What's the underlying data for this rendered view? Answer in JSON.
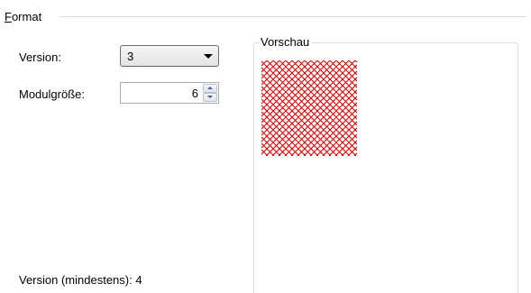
{
  "format": {
    "title_underlined": "F",
    "title_rest": "ormat"
  },
  "version": {
    "label": "Version:",
    "selected": "3"
  },
  "module_size": {
    "label": "Modulgröße:",
    "value": "6"
  },
  "preview": {
    "title": "Vorschau",
    "pattern_color": "#ff0000"
  },
  "min_version": {
    "label": "Version (mindestens):  4"
  },
  "icons": {
    "dropdown": "chevron-down-icon",
    "spin_up": "spin-up-icon",
    "spin_down": "spin-down-icon"
  },
  "colors": {
    "separator": "#d5dfe5",
    "pattern": "#ff0000"
  }
}
